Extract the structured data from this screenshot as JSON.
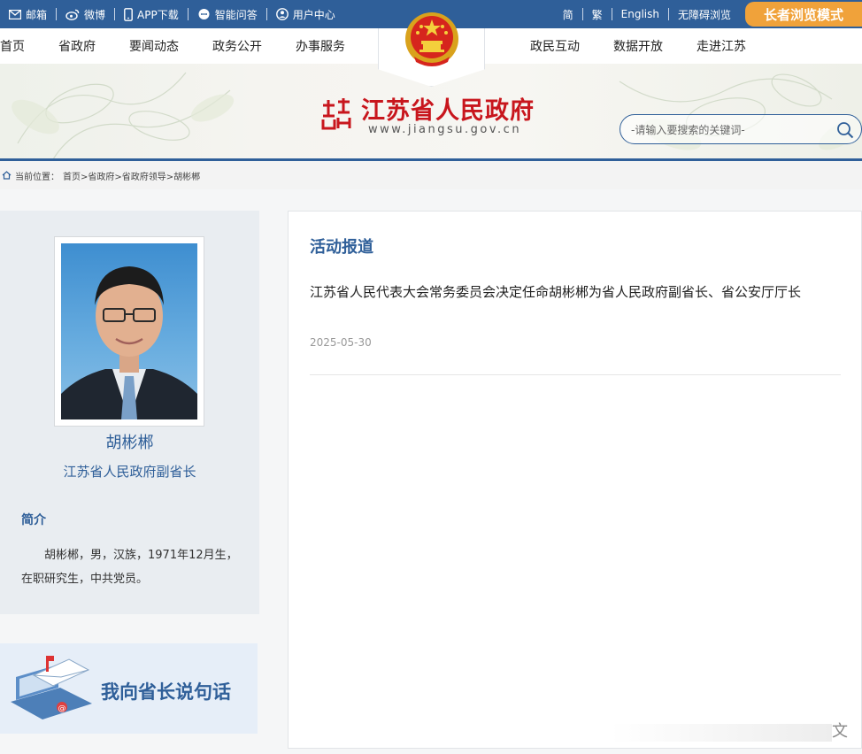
{
  "topbar": {
    "left": [
      {
        "icon": "mail-icon",
        "label": "邮箱"
      },
      {
        "icon": "weibo-icon",
        "label": "微博"
      },
      {
        "icon": "phone-icon",
        "label": "APP下载"
      },
      {
        "icon": "chat-icon",
        "label": "智能问答"
      },
      {
        "icon": "user-icon",
        "label": "用户中心"
      }
    ],
    "right": [
      "简",
      "繁",
      "English",
      "无障碍浏览"
    ],
    "elder_mode": "长者浏览模式",
    "bg_color": "#2f5f99",
    "elder_color": "#f0a23a"
  },
  "nav": {
    "left": [
      "首页",
      "省政府",
      "要闻动态",
      "政务公开",
      "办事服务"
    ],
    "right": [
      "政民互动",
      "数据开放",
      "走进江苏"
    ]
  },
  "header": {
    "site_name": "江苏省人民政府",
    "site_url": "www.jiangsu.gov.cn",
    "search_placeholder": "-请输入要搜索的关键词-",
    "brand_red": "#c8161d"
  },
  "breadcrumb": {
    "prefix": "当前位置：",
    "path": "首页>省政府>省政府领导>胡彬郴"
  },
  "profile": {
    "name": "胡彬郴",
    "title": "江苏省人民政府副省长",
    "intro_heading": "简介",
    "intro_text": "胡彬郴，男，汉族，1971年12月生，在职研究生，中共党员。"
  },
  "mailbox": {
    "label": "我向省长说句话"
  },
  "activity": {
    "heading": "活动报道",
    "items": [
      {
        "title": "江苏省人民代表大会常务委员会决定任命胡彬郴为省人民政府副省长、省公安厅厅长",
        "date": "2025-05-30"
      }
    ]
  },
  "watermark": "文"
}
